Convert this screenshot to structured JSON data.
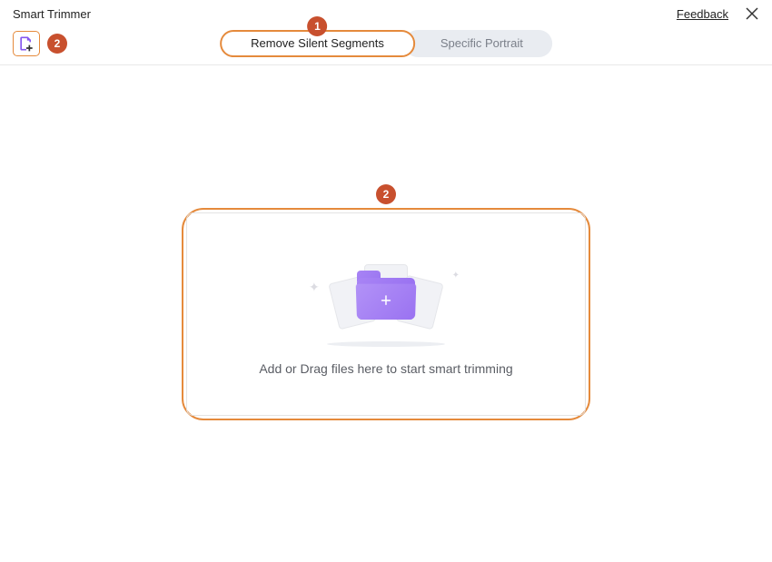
{
  "header": {
    "title": "Smart Trimmer",
    "feedback": "Feedback"
  },
  "tabs": {
    "active": "Remove Silent Segments",
    "inactive": "Specific Portrait"
  },
  "markers": {
    "tab": "1",
    "addfile": "2",
    "dropzone": "2"
  },
  "dropzone": {
    "text": "Add or Drag files here to start smart trimming"
  },
  "icons": {
    "plus": "+",
    "sparkle": "✦"
  }
}
